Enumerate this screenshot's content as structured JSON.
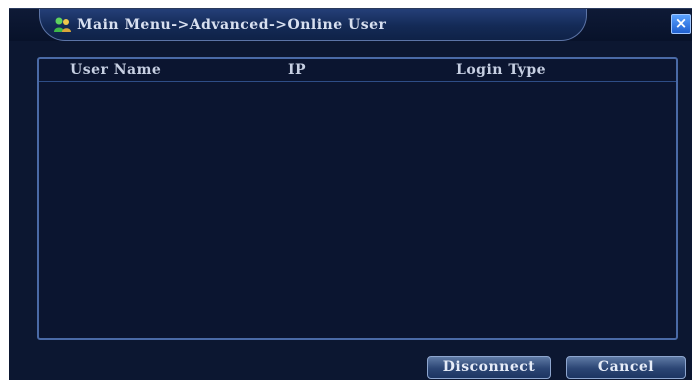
{
  "window": {
    "title": "Main Menu->Advanced->Online User",
    "close_label": "×",
    "title_icon": "users-icon",
    "close_icon": "close-icon"
  },
  "table": {
    "columns": [
      "User Name",
      "IP",
      "Login Type"
    ],
    "rows": []
  },
  "buttons": {
    "disconnect": "Disconnect",
    "cancel": "Cancel"
  },
  "colors": {
    "background": "#0c1731",
    "accent": "#1f5fcf",
    "border": "#4a6aa6",
    "text": "#d8e0f0"
  }
}
